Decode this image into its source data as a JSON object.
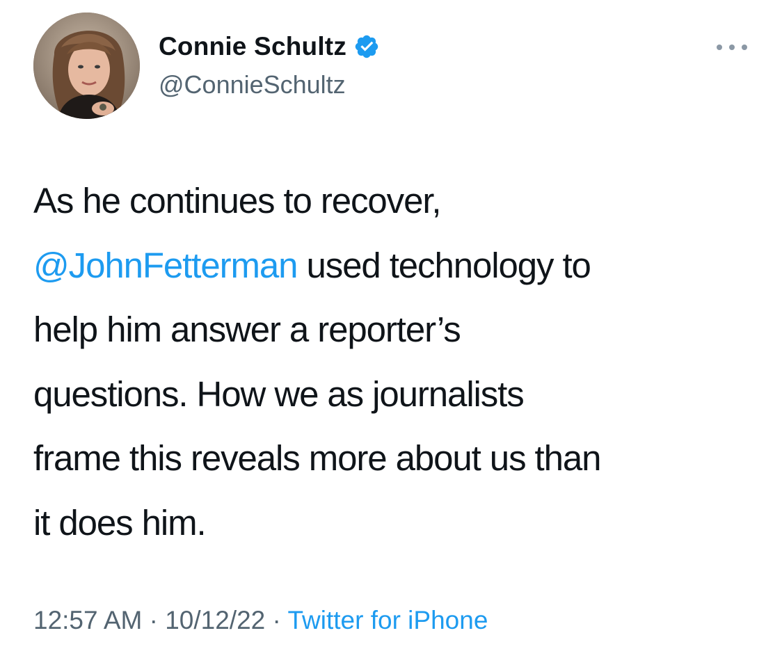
{
  "author": {
    "display_name": "Connie Schultz",
    "handle": "@ConnieSchultz",
    "verified": true,
    "avatar_icon": "profile-photo"
  },
  "tweet": {
    "line1": "As he continues to recover,",
    "mention": "@JohnFetterman",
    "line2_rest": " used technology to",
    "line3": "help him answer a reporter’s",
    "line4": "questions. How we as journalists",
    "line5": "frame this reveals more about us than",
    "line6": "it does him."
  },
  "meta": {
    "time": "12:57 AM",
    "separator1": " · ",
    "date": "10/12/22",
    "separator2": " · ",
    "source": "Twitter for iPhone"
  },
  "colors": {
    "link": "#1d9bf0",
    "secondary_text": "#536471",
    "primary_text": "#0f1419",
    "verified_badge": "#1d9bf0"
  },
  "icons": {
    "more": "more-horizontal-icon",
    "verified": "verified-badge-icon"
  }
}
